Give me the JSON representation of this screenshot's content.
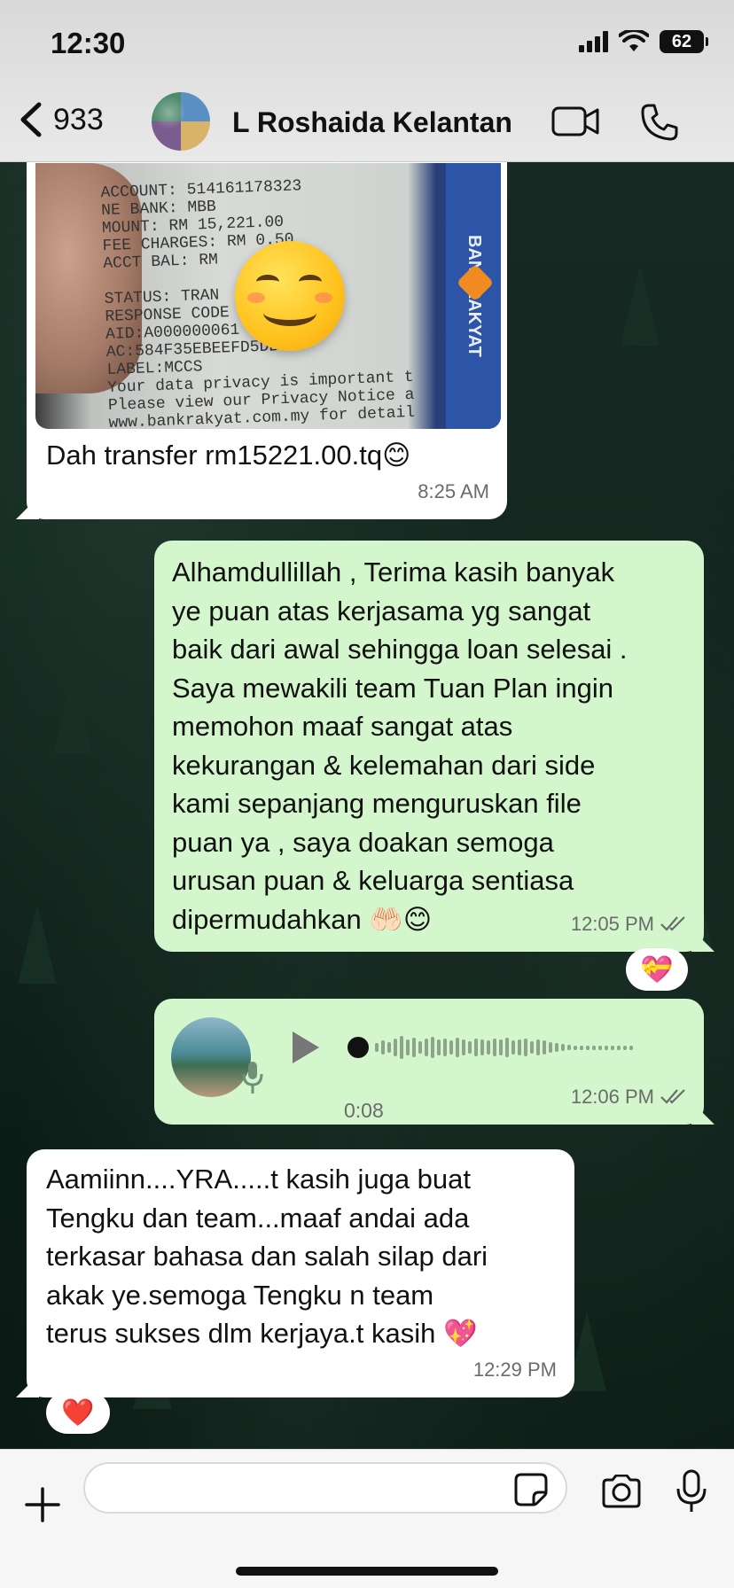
{
  "status_bar": {
    "time": "12:30",
    "battery": "62"
  },
  "header": {
    "back_count": "933",
    "contact_name": "L Roshaida Kelantan"
  },
  "messages": [
    {
      "id": "m1",
      "direction": "incoming",
      "type": "image",
      "image_text": "ACCOUNT: 514161178323\nNE BANK: MBB\nMOUNT: RM 15,221.00\nFEE CHARGES: RM 0.50\nACCT BAL: RM\n\nSTATUS: TRAN       CEPTED\nRESPONSE CODE\nAID:A000000061\nAC:584F35EBEEFD5DB9\nLABEL:MCCS\nYour data privacy is important t\nPlease view our Privacy Notice a\nwww.bankrakyat.com.my for detail",
      "image_brand": "BANKRAKYAT",
      "caption": "Dah transfer rm15221.00.tq😊",
      "time": "8:25 AM"
    },
    {
      "id": "m2",
      "direction": "outgoing",
      "type": "text",
      "lines": [
        "Alhamdullillah , Terima kasih banyak",
        "ye puan atas kerjasama yg sangat",
        "baik dari awal sehingga loan selesai .",
        "Saya mewakili team Tuan Plan ingin",
        "memohon maaf sangat atas",
        "kekurangan & kelemahan dari side",
        "kami sepanjang menguruskan file",
        "puan ya , saya doakan semoga",
        "urusan puan & keluarga sentiasa",
        "dipermudahkan 🤲🏻😊"
      ],
      "time": "12:05 PM",
      "reaction": "💝"
    },
    {
      "id": "m3",
      "direction": "outgoing",
      "type": "voice",
      "duration": "0:08",
      "time": "12:06 PM"
    },
    {
      "id": "m4",
      "direction": "incoming",
      "type": "text",
      "lines": [
        "Aamiinn....YRA.....t kasih juga buat",
        "Tengku dan team...maaf andai ada",
        "terkasar bahasa dan salah silap dari",
        "akak ye.semoga Tengku n team",
        "terus sukses dlm kerjaya.t kasih 💖"
      ],
      "time": "12:29 PM",
      "reaction": "❤️"
    }
  ],
  "composer": {
    "placeholder": ""
  },
  "colors": {
    "outgoing_bubble": "#d3f6cc",
    "incoming_bubble": "#ffffff",
    "read_ticks": "#6b6b6b"
  }
}
